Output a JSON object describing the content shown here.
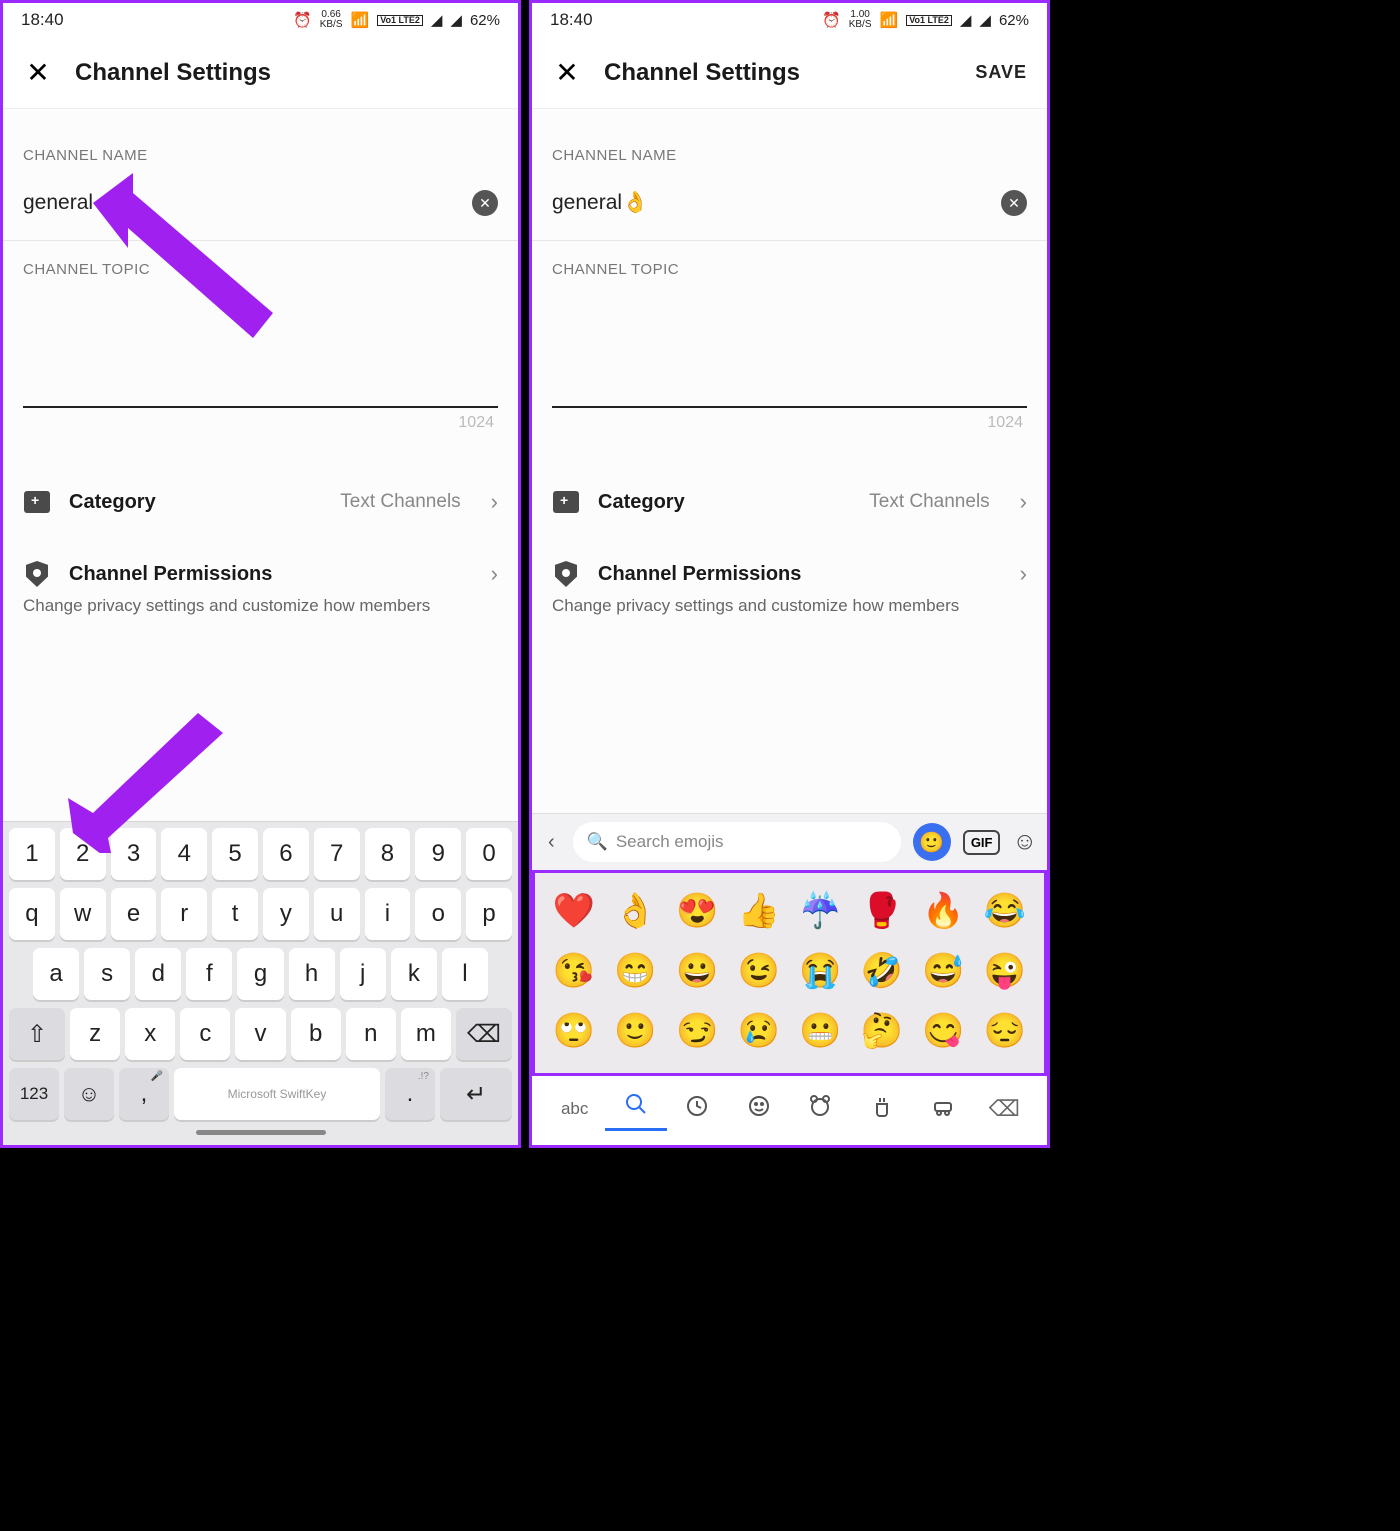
{
  "left": {
    "status": {
      "time": "18:40",
      "kbs": "0.66",
      "kbs_unit": "KB/S",
      "lte": "Vo1 LTE2",
      "battery": "62%"
    },
    "header": {
      "title": "Channel Settings"
    },
    "channel_name": {
      "label": "CHANNEL NAME",
      "value": "general"
    },
    "channel_topic": {
      "label": "CHANNEL TOPIC",
      "char_limit": "1024"
    },
    "category": {
      "label": "Category",
      "value": "Text Channels"
    },
    "permissions": {
      "label": "Channel Permissions",
      "desc": "Change privacy settings and customize how members"
    },
    "keyboard": {
      "row_num": [
        "1",
        "2",
        "3",
        "4",
        "5",
        "6",
        "7",
        "8",
        "9",
        "0"
      ],
      "row_q": [
        "q",
        "w",
        "e",
        "r",
        "t",
        "y",
        "u",
        "i",
        "o",
        "p"
      ],
      "row_a": [
        "a",
        "s",
        "d",
        "f",
        "g",
        "h",
        "j",
        "k",
        "l"
      ],
      "row_z": [
        "z",
        "x",
        "c",
        "v",
        "b",
        "n",
        "m"
      ],
      "sym": "123",
      "space_brand": "Microsoft SwiftKey",
      "period_sub": ".!?",
      "comma_sub": ","
    }
  },
  "right": {
    "status": {
      "time": "18:40",
      "kbs": "1.00",
      "kbs_unit": "KB/S",
      "lte": "Vo1 LTE2",
      "battery": "62%"
    },
    "header": {
      "title": "Channel Settings",
      "save": "SAVE"
    },
    "channel_name": {
      "label": "CHANNEL NAME",
      "value": "general👌"
    },
    "channel_topic": {
      "label": "CHANNEL TOPIC",
      "char_limit": "1024"
    },
    "category": {
      "label": "Category",
      "value": "Text Channels"
    },
    "permissions": {
      "label": "Channel Permissions",
      "desc": "Change privacy settings and customize how members"
    },
    "emoji_panel": {
      "search_placeholder": "Search emojis",
      "gif": "GIF",
      "abc": "abc",
      "grid": [
        [
          "❤️",
          "👌",
          "😍",
          "👍",
          "☔",
          "🥊",
          "🔥",
          "😂"
        ],
        [
          "😘",
          "😁",
          "😀",
          "😉",
          "😭",
          "🤣",
          "😅",
          "😜"
        ],
        [
          "🙄",
          "🙂",
          "😏",
          "😢",
          "😬",
          "🤔",
          "😋",
          "😔"
        ]
      ]
    }
  }
}
